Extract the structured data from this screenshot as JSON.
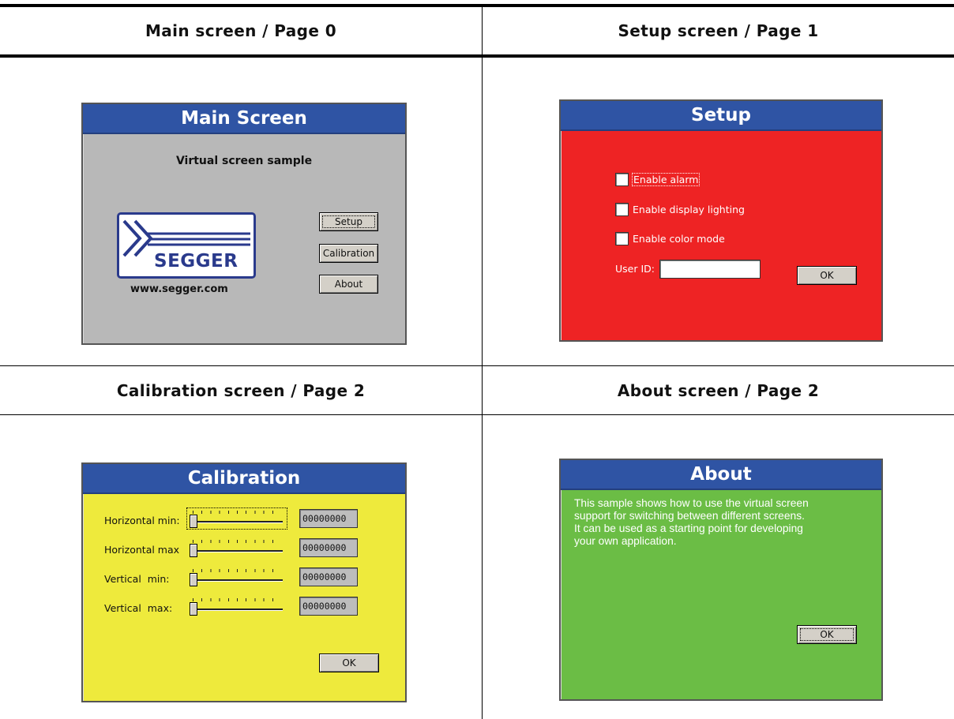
{
  "table": {
    "headers": [
      "Main screen / Page 0",
      "Setup screen / Page 1",
      "Calibration screen / Page 2",
      "About screen / Page 2"
    ]
  },
  "main_screen": {
    "title": "Main Screen",
    "subtitle": "Virtual screen sample",
    "logo_text": "SEGGER",
    "website": "www.segger.com",
    "buttons": {
      "setup": "Setup",
      "calibration": "Calibration",
      "about": "About"
    },
    "background": "#b8b8b8"
  },
  "setup_screen": {
    "title": "Setup",
    "checkboxes": [
      {
        "label": "Enable alarm",
        "checked": false
      },
      {
        "label": "Enable display lighting",
        "checked": false
      },
      {
        "label": "Enable color mode",
        "checked": false
      }
    ],
    "user_id_label": "User ID:",
    "user_id_value": "",
    "ok_label": "OK",
    "background": "#ee2324"
  },
  "calibration_screen": {
    "title": "Calibration",
    "rows": [
      {
        "label": "Horizontal min:",
        "value": "00000000"
      },
      {
        "label": "Horizontal max",
        "value": "00000000"
      },
      {
        "label": "Vertical  min:",
        "value": "00000000"
      },
      {
        "label": "Vertical  max:",
        "value": "00000000"
      }
    ],
    "ok_label": "OK",
    "background": "#eeea3c"
  },
  "about_screen": {
    "title": "About",
    "text_lines": [
      "This sample shows how to use the virtual screen",
      "support for switching between different screens.",
      "It can be used as a starting point for developing",
      "your own application."
    ],
    "ok_label": "OK",
    "background": "#6bbd45"
  },
  "colors": {
    "title_bar": "#2f54a4"
  }
}
